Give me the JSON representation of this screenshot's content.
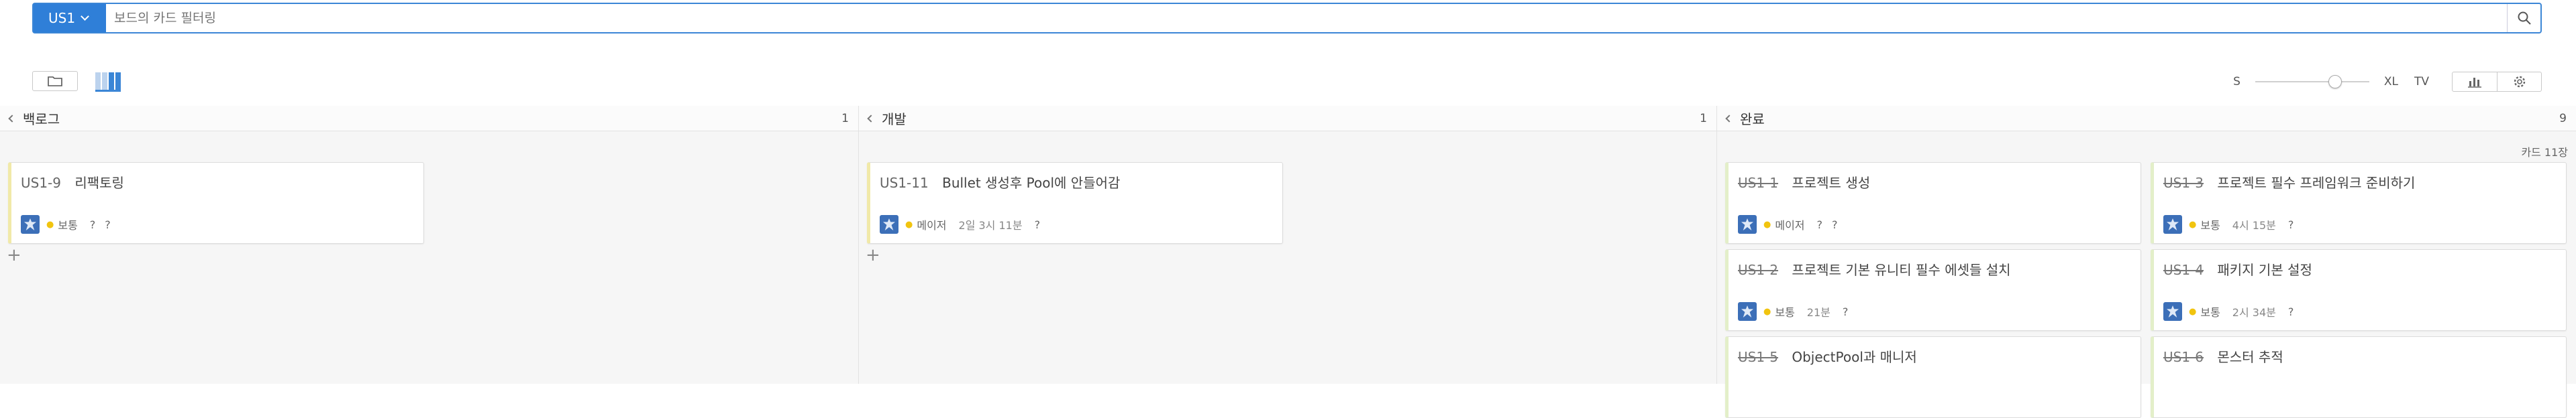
{
  "filter": {
    "project_button": "US1",
    "placeholder": "보드의 카드 필터링"
  },
  "toolbar": {
    "size_min": "S",
    "size_max": "XL",
    "tv": "TV",
    "card_size_level": 0.7
  },
  "columns": [
    {
      "title": "백로그",
      "count": "1",
      "cards": [
        {
          "id": "US1-9",
          "title": "리팩토링",
          "priority": "보통",
          "time": "",
          "q1": "?",
          "q2": "?",
          "done": false
        }
      ]
    },
    {
      "title": "개발",
      "count": "1",
      "cards": [
        {
          "id": "US1-11",
          "title": "Bullet 생성후 Pool에 안들어감",
          "priority": "메이저",
          "time": "2일 3시 11분",
          "q1": "",
          "q2": "?",
          "done": false
        }
      ]
    },
    {
      "title": "완료",
      "count": "9",
      "card_count": "카드 11장",
      "cards": [
        {
          "id": "US1-1",
          "title": "프로젝트 생성",
          "priority": "메이저",
          "time": "",
          "q1": "?",
          "q2": "?",
          "done": true
        },
        {
          "id": "US1-3",
          "title": "프로젝트 필수 프레임워크 준비하기",
          "priority": "보통",
          "time": "4시 15분",
          "q1": "",
          "q2": "?",
          "done": true
        },
        {
          "id": "US1-2",
          "title": "프로젝트 기본 유니티 필수 에셋들 설치",
          "priority": "보통",
          "time": "21분",
          "q1": "",
          "q2": "?",
          "done": true
        },
        {
          "id": "US1-4",
          "title": "패키지 기본 설정",
          "priority": "보통",
          "time": "2시 34분",
          "q1": "",
          "q2": "?",
          "done": true
        },
        {
          "id": "US1-5",
          "title": "ObjectPool과 매니저",
          "priority": "",
          "time": "",
          "q1": "",
          "q2": "",
          "done": true
        },
        {
          "id": "US1-6",
          "title": "몬스터 추적",
          "priority": "",
          "time": "",
          "q1": "",
          "q2": "",
          "done": true
        }
      ]
    }
  ],
  "colors": {
    "accent": "#2f7fd8",
    "card_border_normal": "#f1e9a8",
    "card_border_done": "#e3efc9"
  }
}
